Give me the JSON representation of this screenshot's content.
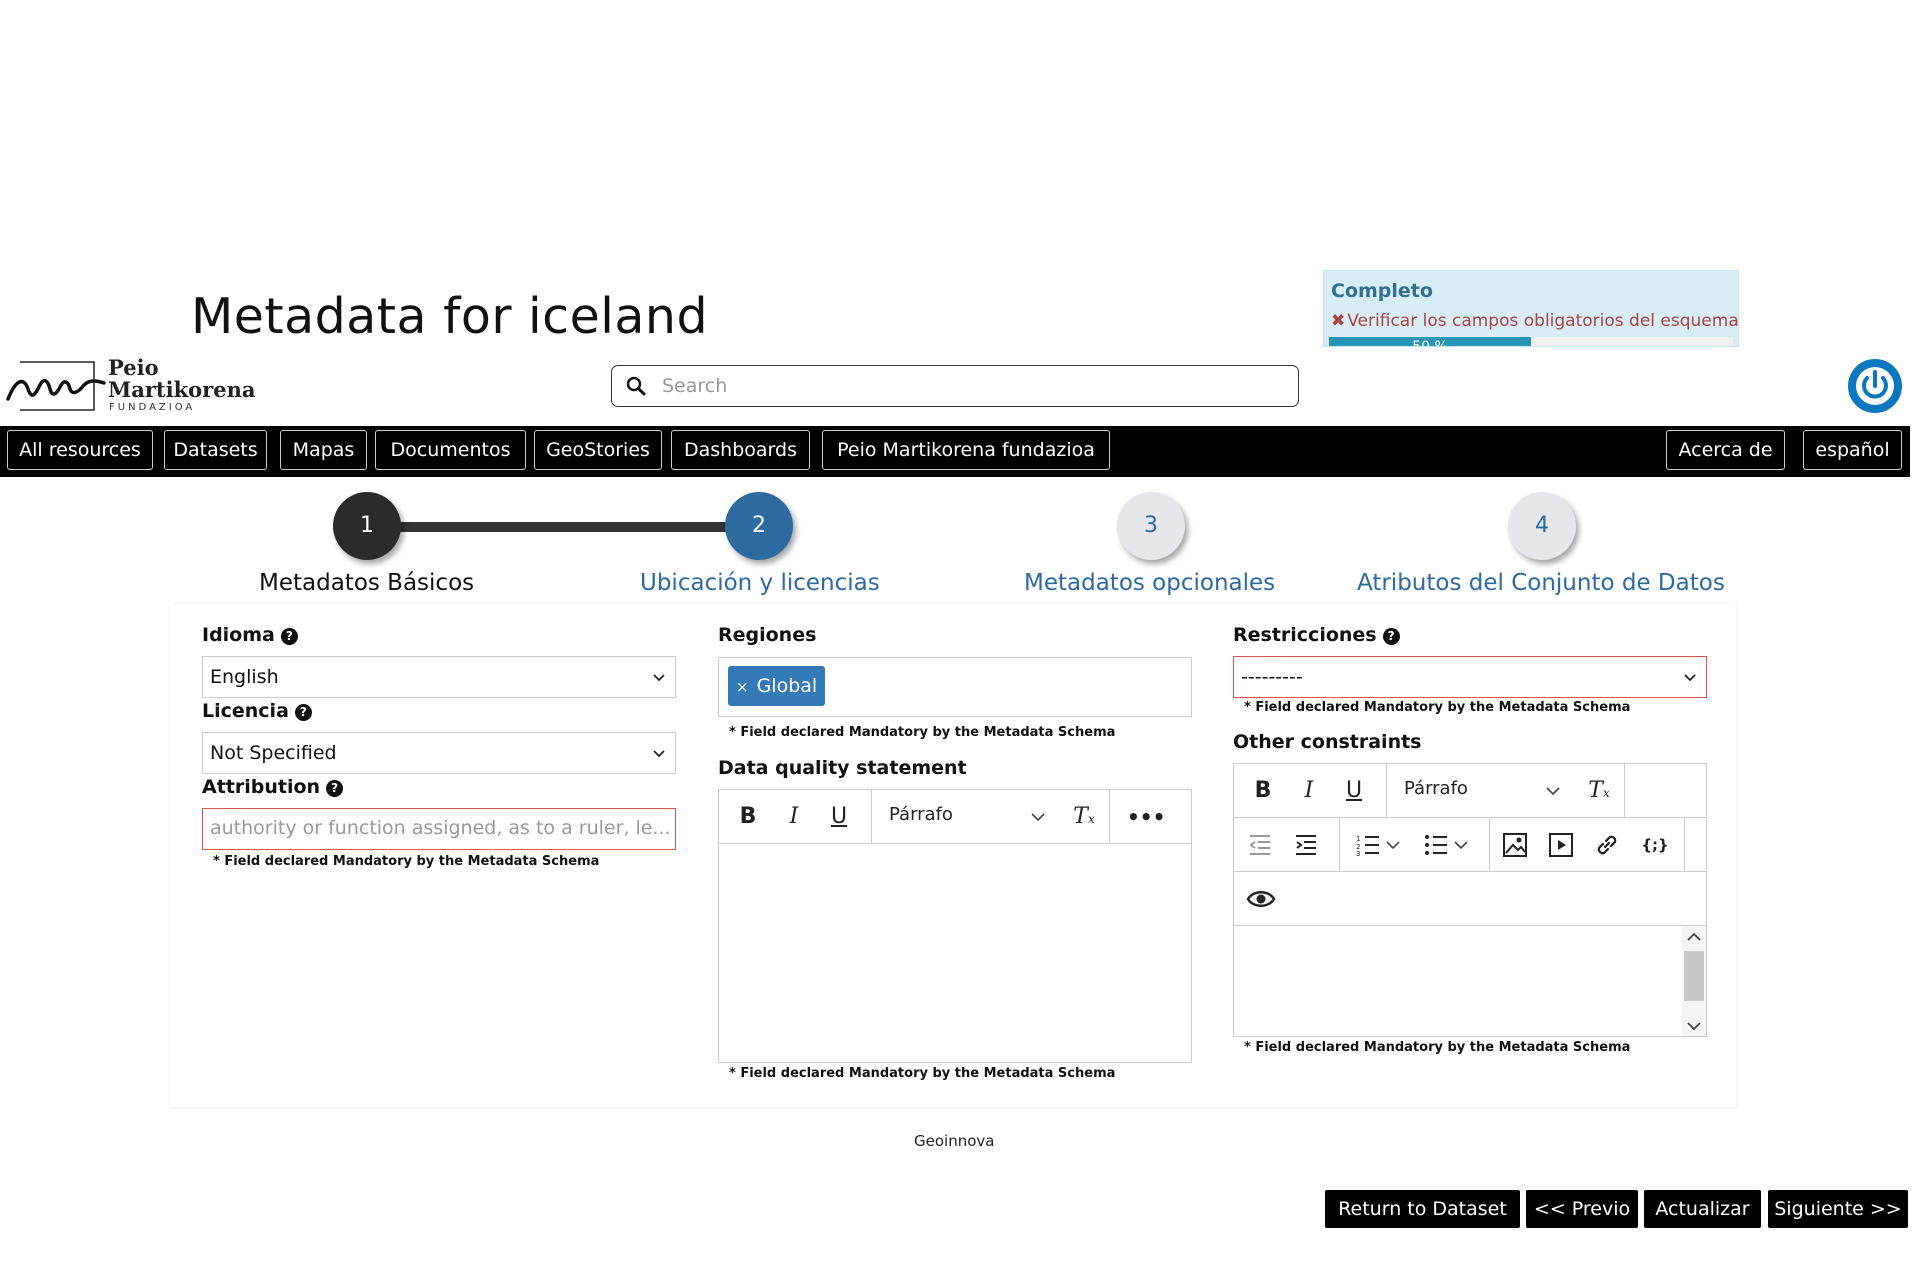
{
  "page": {
    "title": "Metadata for iceland"
  },
  "progress": {
    "title": "Completo",
    "warning": "Verificar los campos obligatorios del esquema",
    "percent_label": "50 %",
    "percent": 50,
    "color": "#2795b6"
  },
  "brand": {
    "line1": "Peio",
    "line2": "Martikorena",
    "line3": "FUNDAZIOA"
  },
  "search": {
    "placeholder": "Search",
    "icon": "search-icon"
  },
  "power": {
    "icon": "power-icon",
    "color": "#0a77c0"
  },
  "nav": {
    "items": [
      "All resources",
      "Datasets",
      "Mapas",
      "Documentos",
      "GeoStories",
      "Dashboards",
      "Peio Martikorena fundazioa"
    ],
    "about": "Acerca de",
    "language": "español"
  },
  "steps": [
    {
      "number": "1",
      "label": "Metadatos Básicos",
      "state": "completed"
    },
    {
      "number": "2",
      "label": "Ubicación y licencias",
      "state": "active"
    },
    {
      "number": "3",
      "label": "Metadatos opcionales",
      "state": "pending"
    },
    {
      "number": "4",
      "label": "Atributos del Conjunto de Datos",
      "state": "pending"
    }
  ],
  "form": {
    "idioma": {
      "label": "Idioma",
      "value": "English"
    },
    "licencia": {
      "label": "Licencia",
      "value": "Not Specified"
    },
    "attribution": {
      "label": "Attribution",
      "placeholder": "authority or function assigned, as to a ruler, le..."
    },
    "regiones": {
      "label": "Regiones",
      "tag": "Global"
    },
    "data_quality": {
      "label": "Data quality statement"
    },
    "restricciones": {
      "label": "Restricciones",
      "value": "---------"
    },
    "other_constraints": {
      "label": "Other constraints"
    },
    "mandatory_note": "* Field declared Mandatory by the Metadata Schema",
    "paragraph_label": "Párrafo"
  },
  "footer": {
    "text": "Geoinnova"
  },
  "actions": {
    "return": "Return to Dataset",
    "previous": "<< Previo",
    "update": "Actualizar",
    "next": "Siguiente >>"
  }
}
